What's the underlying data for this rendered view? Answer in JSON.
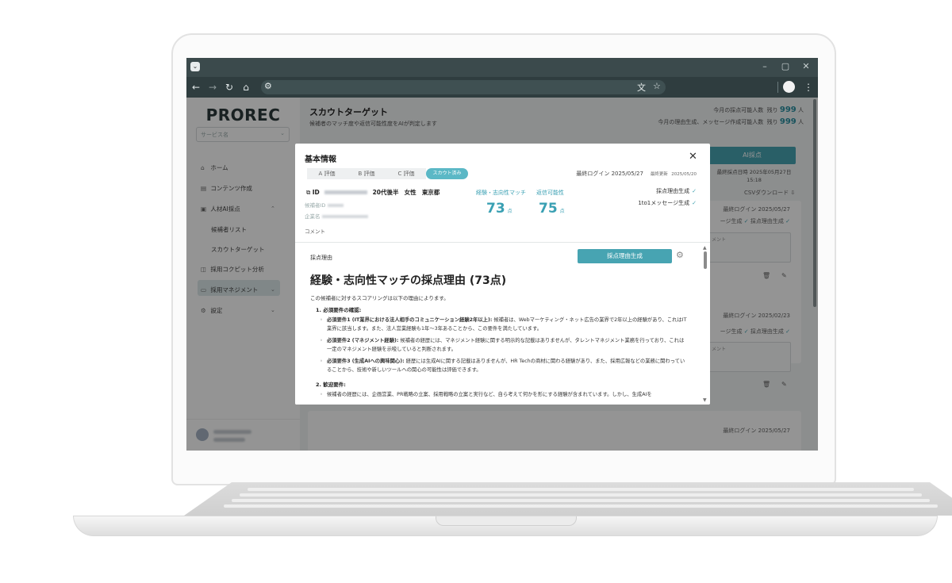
{
  "app": {
    "logo": "PROREC",
    "org_select_placeholder": "サービス名"
  },
  "sidebar": {
    "items": [
      {
        "icon": "home-icon",
        "label": "ホーム"
      },
      {
        "icon": "document-icon",
        "label": "コンテンツ作成"
      },
      {
        "icon": "ai-icon",
        "label": "人材AI採点"
      },
      {
        "icon": "",
        "label": "候補者リスト"
      },
      {
        "icon": "",
        "label": "スカウトターゲット"
      },
      {
        "icon": "chart-icon",
        "label": "採用コクピット分析"
      },
      {
        "icon": "briefcase-icon",
        "label": "採用マネジメント"
      },
      {
        "icon": "gear-icon",
        "label": "設定"
      }
    ]
  },
  "header": {
    "title": "スカウトターゲット",
    "subtitle": "候補者のマッチ度や返信可能性度をAIが判定します",
    "stat1_label": "今月の採点可能人数",
    "stat1_prefix": "残り",
    "stat1_value": "999",
    "stat1_unit": "人",
    "stat2_label": "今月の理由生成、メッセージ作成可能人数",
    "stat2_prefix": "残り",
    "stat2_value": "999",
    "stat2_unit": "人"
  },
  "toolbar": {
    "ai_button": "AI採点",
    "last_scored": "最終採点日時 2025年05月27日",
    "last_scored_time": "15:18",
    "csv_download": "CSVダウンロード"
  },
  "cards": [
    {
      "last_login": "最終ログイン 2025/05/27",
      "msg_gen": "ージ生成",
      "reason_gen": "採点理由生成",
      "comment": "メント"
    },
    {
      "last_login": "最終ログイン 2025/02/23",
      "msg_gen": "ージ生成",
      "reason_gen": "採点理由生成",
      "comment": "メント"
    },
    {
      "last_login": "最終ログイン 2025/05/27"
    }
  ],
  "modal": {
    "title": "基本情報",
    "tabs": [
      "A 評価",
      "B 評価",
      "C 評価"
    ],
    "status_pill": "スカウト済み",
    "last_login": "最終ログイン 2025/05/27",
    "last_update_label": "最終更新",
    "last_update": "2025/05/20",
    "id_label": "ID",
    "age": "20代後半",
    "gender": "女性",
    "location": "東京都",
    "candidate_id_label": "候補者ID",
    "company_label": "企業名",
    "comment_label": "コメント",
    "score1_label": "経験・志向性マッチ",
    "score1_value": "73",
    "score2_label": "返信可能性",
    "score2_value": "75",
    "score_unit": "点",
    "reason_status": "採点理由生成",
    "message_status": "1to1メッセージ生成",
    "reason_section_label": "採点理由",
    "generate_button": "採点理由生成",
    "heading": "経験・志向性マッチの採点理由 (73点)",
    "intro": "この候補者に対するスコアリングは以下の理由によります。",
    "section1": "1. 必須要件の確認:",
    "req1_title": "必須要件1 (IT業界における法人相手のコミュニケーション経験2年以上):",
    "req1_text": " 候補者は、Webマーケティング・ネット広告の業界で2年以上の経験があり、これはIT業界に該当します。また、法人営業経験も1年～3年あることから、この要件を満たしています。",
    "req2_title": "必須要件2 (マネジメント経験):",
    "req2_text": " 候補者の経歴には、マネジメント経験に関する明示的な記載はありませんが、タレントマネジメント業務を行っており、これは一定のマネジメント経験を示唆していると判断されます。",
    "req3_title": "必須要件3 (生成AIへの興味関心):",
    "req3_text": " 経歴には生成AIに関する記載はありませんが、HR Techの商材に関わる経験があり、また、採用広報などの業務に関わっていることから、技術や新しいツールへの関心の可能性は評価できます。",
    "section2": "2. 歓迎要件:",
    "welcome1_text": "候補者の経歴には、企画営業、PR戦略の立案、採用戦略の立案と実行など、自ら考えて何かを形にする経験が含まれています。しかし、生成AIを"
  }
}
